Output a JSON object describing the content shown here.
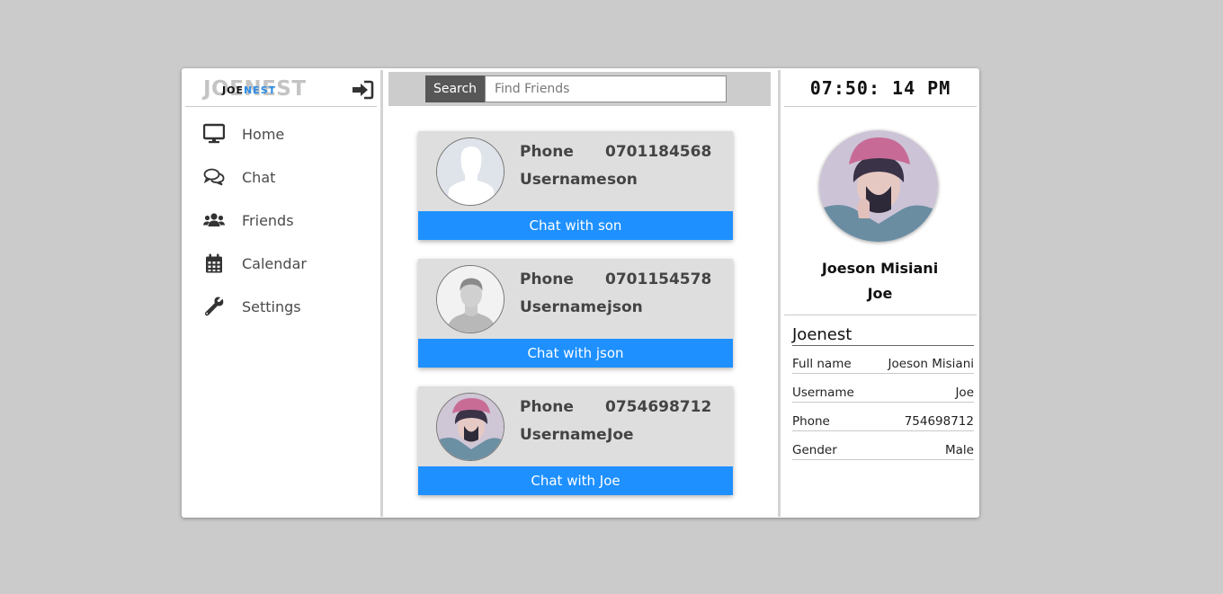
{
  "brand": {
    "bg_text": "JOENEST",
    "fg_part1": "JOE",
    "fg_part2": "NEST"
  },
  "sidebar": {
    "items": [
      {
        "label": "Home",
        "icon": "monitor-icon"
      },
      {
        "label": "Chat",
        "icon": "chat-bubbles-icon"
      },
      {
        "label": "Friends",
        "icon": "users-icon"
      },
      {
        "label": "Calendar",
        "icon": "calendar-icon"
      },
      {
        "label": "Settings",
        "icon": "wrench-icon"
      }
    ]
  },
  "search": {
    "button_label": "Search",
    "placeholder": "Find Friends",
    "value": ""
  },
  "friends": [
    {
      "phone_label": "Phone",
      "phone": "0701184568",
      "username_label": "Username",
      "username": "son",
      "button_label": "Chat with son",
      "avatar": "silhouette-avatar"
    },
    {
      "phone_label": "Phone",
      "phone": "0701154578",
      "username_label": "Username",
      "username": "json",
      "button_label": "Chat with json",
      "avatar": "default-male-avatar"
    },
    {
      "phone_label": "Phone",
      "phone": "0754698712",
      "username_label": "Username",
      "username": "Joe",
      "button_label": "Chat with Joe",
      "avatar": "anime-profile-avatar"
    }
  ],
  "clock": "07:50: 14 PM",
  "profile": {
    "name": "Joeson Misiani",
    "username": "Joe",
    "info_title": "Joenest",
    "info": [
      {
        "key": "Full name",
        "value": "Joeson Misiani"
      },
      {
        "key": "Username",
        "value": "Joe"
      },
      {
        "key": "Phone",
        "value": "754698712"
      },
      {
        "key": "Gender",
        "value": "Male"
      }
    ]
  },
  "colors": {
    "accent": "#1e90ff",
    "background": "#cbcbcb",
    "card": "#dedede",
    "search_button": "#575757",
    "brand_blue": "#2b8de6"
  }
}
